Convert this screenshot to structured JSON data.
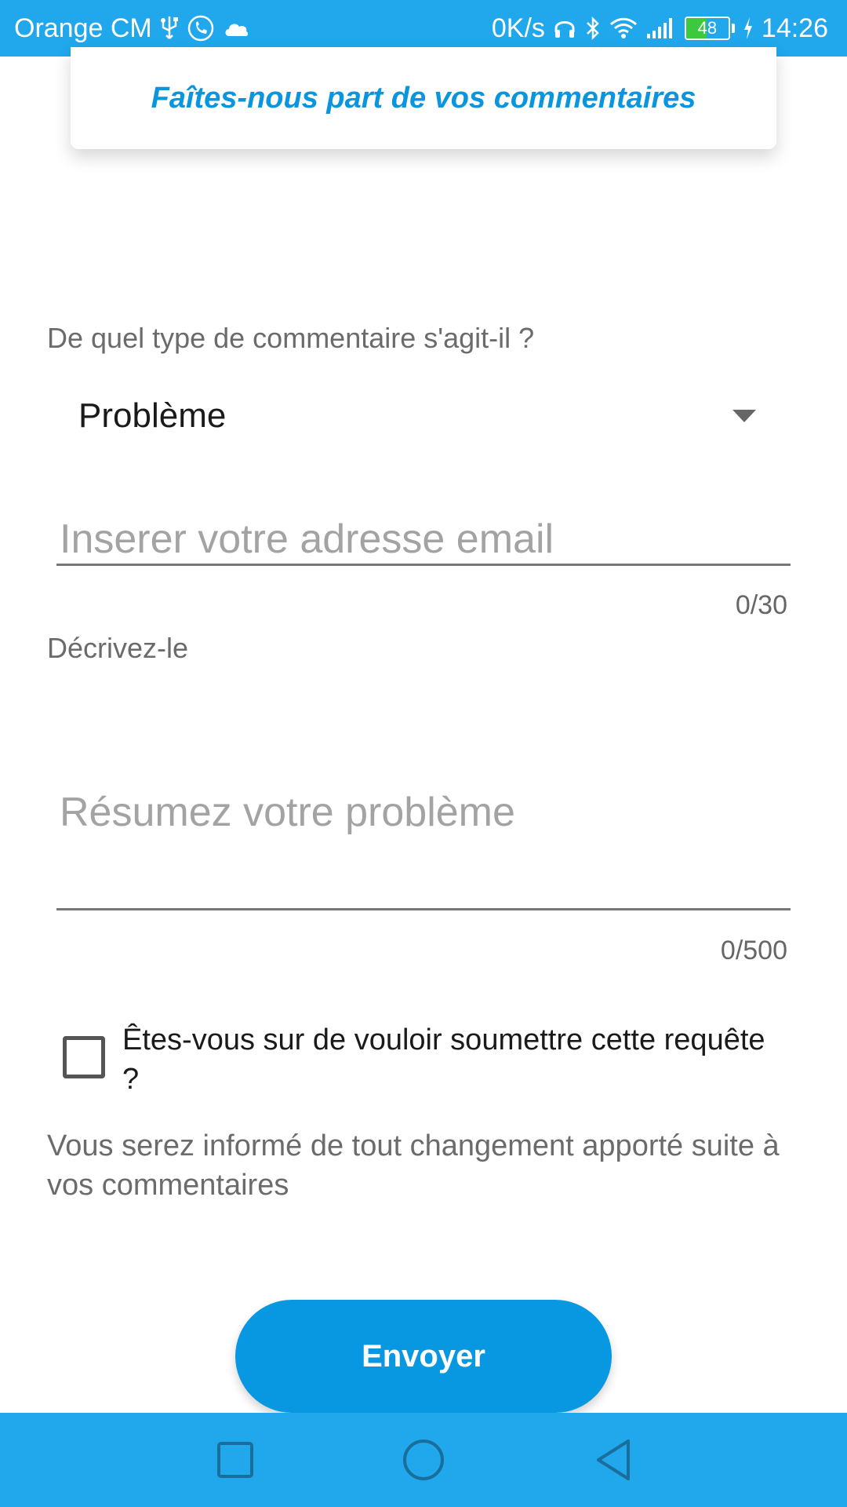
{
  "status_bar": {
    "carrier": "Orange CM",
    "net_speed": "0K/s",
    "battery_level": "48",
    "battery_fraction": 0.48,
    "time": "14:26",
    "icons": [
      "usb-icon",
      "call-icon",
      "cloud-icon",
      "headset-icon",
      "bluetooth-icon",
      "wifi-icon",
      "signal-icon",
      "battery-icon",
      "charging-icon"
    ]
  },
  "header": {
    "title": "Faîtes-nous part de vos commentaires"
  },
  "form": {
    "type_label": "De quel type de commentaire s'agit-il ?",
    "type_selected": "Problème",
    "email_placeholder": "Inserer votre adresse email",
    "email_value": "",
    "email_counter": "0/30",
    "describe_label": "Décrivez-le",
    "description_placeholder": "Résumez votre problème",
    "description_value": "",
    "description_counter": "0/500",
    "confirm_text": "Êtes-vous sur de vouloir soumettre cette requête ?",
    "confirm_checked": false,
    "info_text": "Vous serez informé de tout changement apporté suite à vos commentaires",
    "submit_label": "Envoyer"
  },
  "nav_bar": {
    "buttons": [
      "recent-apps-icon",
      "home-icon",
      "back-icon"
    ]
  },
  "colors": {
    "accent": "#20a7ec",
    "button": "#0898e2",
    "title": "#0a96de"
  }
}
